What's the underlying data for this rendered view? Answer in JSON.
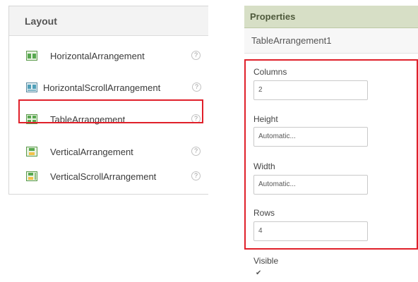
{
  "layout_palette": {
    "title": "Layout",
    "items": [
      {
        "label": "HorizontalArrangement",
        "icon": "horizontal-arrangement-icon",
        "help": "?"
      },
      {
        "label": "HorizontalScrollArrangement",
        "icon": "horizontal-scroll-arrangement-icon",
        "help": "?"
      },
      {
        "label": "TableArrangement",
        "icon": "table-arrangement-icon",
        "help": "?"
      },
      {
        "label": "VerticalArrangement",
        "icon": "vertical-arrangement-icon",
        "help": "?"
      },
      {
        "label": "VerticalScrollArrangement",
        "icon": "vertical-scroll-arrangement-icon",
        "help": "?"
      }
    ]
  },
  "properties": {
    "title": "Properties",
    "component_name": "TableArrangement1",
    "columns": {
      "label": "Columns",
      "value": "2"
    },
    "height": {
      "label": "Height",
      "value": "Automatic..."
    },
    "width": {
      "label": "Width",
      "value": "Automatic..."
    },
    "rows": {
      "label": "Rows",
      "value": "4"
    },
    "visible": {
      "label": "Visible",
      "checked": true,
      "check_glyph": "✔"
    }
  },
  "colors": {
    "highlight": "#e0202a",
    "properties_header": "#d7dfc6",
    "palette_icon_green": "#4fae4f"
  }
}
